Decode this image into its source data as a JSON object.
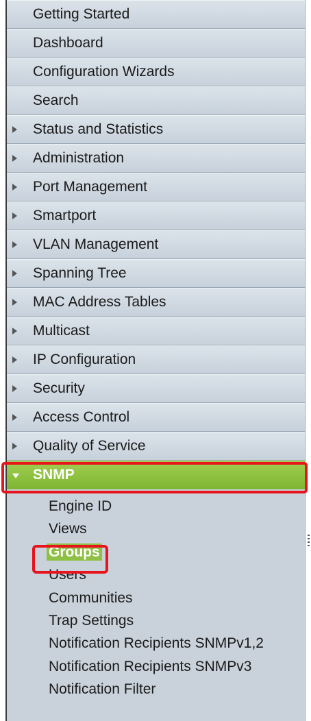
{
  "nav": {
    "items": [
      {
        "label": "Getting Started",
        "expandable": false
      },
      {
        "label": "Dashboard",
        "expandable": false
      },
      {
        "label": "Configuration Wizards",
        "expandable": false
      },
      {
        "label": "Search",
        "expandable": false
      },
      {
        "label": "Status and Statistics",
        "expandable": true
      },
      {
        "label": "Administration",
        "expandable": true
      },
      {
        "label": "Port Management",
        "expandable": true
      },
      {
        "label": "Smartport",
        "expandable": true
      },
      {
        "label": "VLAN Management",
        "expandable": true
      },
      {
        "label": "Spanning Tree",
        "expandable": true
      },
      {
        "label": "MAC Address Tables",
        "expandable": true
      },
      {
        "label": "Multicast",
        "expandable": true
      },
      {
        "label": "IP Configuration",
        "expandable": true
      },
      {
        "label": "Security",
        "expandable": true
      },
      {
        "label": "Access Control",
        "expandable": true
      },
      {
        "label": "Quality of Service",
        "expandable": true
      }
    ],
    "expanded": {
      "label": "SNMP",
      "children": [
        "Engine ID",
        "Views",
        "Groups",
        "Users",
        "Communities",
        "Trap Settings",
        "Notification Recipients SNMPv1,2",
        "Notification Recipients SNMPv3",
        "Notification Filter"
      ],
      "active_child": "Groups"
    }
  },
  "colors": {
    "nav_bg": "#c9d2db",
    "expanded_bg": "#8ec043",
    "highlight": "#e8141d"
  }
}
